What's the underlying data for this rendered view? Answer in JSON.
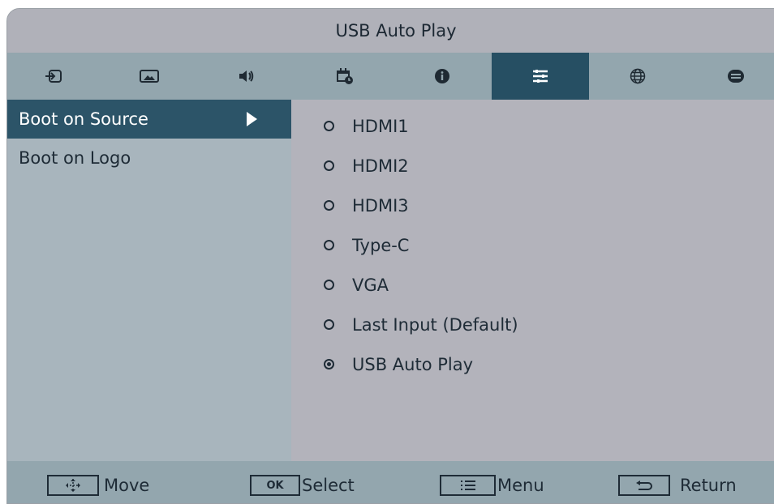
{
  "title": "USB Auto Play",
  "tabs": [
    {
      "icon": "input-icon",
      "active": false
    },
    {
      "icon": "picture-icon",
      "active": false
    },
    {
      "icon": "speaker-icon",
      "active": false
    },
    {
      "icon": "schedule-icon",
      "active": false
    },
    {
      "icon": "info-icon",
      "active": false
    },
    {
      "icon": "settings-sliders-icon",
      "active": true
    },
    {
      "icon": "globe-icon",
      "active": false
    },
    {
      "icon": "keyboard-icon",
      "active": false
    }
  ],
  "menu": [
    {
      "label": "Boot on Source",
      "selected": true
    },
    {
      "label": "Boot on Logo",
      "selected": false
    }
  ],
  "options": [
    {
      "label": "HDMI1",
      "checked": false
    },
    {
      "label": "HDMI2",
      "checked": false
    },
    {
      "label": "HDMI3",
      "checked": false
    },
    {
      "label": "Type-C",
      "checked": false
    },
    {
      "label": "VGA",
      "checked": false
    },
    {
      "label": "Last Input (Default)",
      "checked": false
    },
    {
      "label": "USB Auto Play",
      "checked": true
    }
  ],
  "footer": {
    "move_label": "Move",
    "ok_key": "OK",
    "select_label": "Select",
    "menu_label": "Menu",
    "return_label": "Return"
  },
  "colors": {
    "active_tab": "#264f63",
    "tab_bar": "#93a6ae",
    "background": "#b3b3bb",
    "left_panel": "#a8b5bd"
  }
}
